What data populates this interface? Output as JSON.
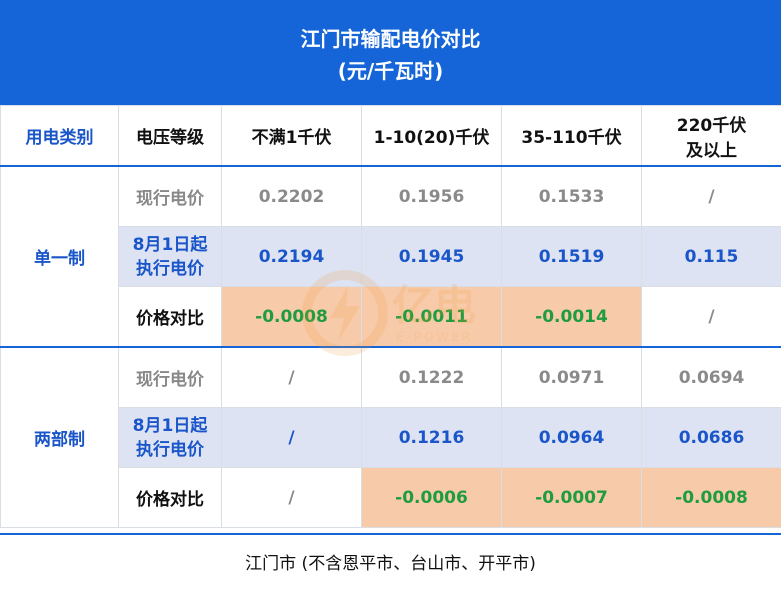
{
  "title": {
    "line1": "江门市输配电价对比",
    "line2": "(元/千瓦时)"
  },
  "header": {
    "category": "用电类别",
    "voltage_level": "电压等级",
    "col1": "不满1千伏",
    "col2": "1-10(20)千伏",
    "col3": "35-110千伏",
    "col4_line1": "220千伏",
    "col4_line2": "及以上"
  },
  "groups": [
    {
      "name": "单一制",
      "rows": [
        {
          "label": "现行电价",
          "values": [
            "0.2202",
            "0.1956",
            "0.1533",
            "/"
          ]
        },
        {
          "label_line1": "8月1日起",
          "label_line2": "执行电价",
          "values": [
            "0.2194",
            "0.1945",
            "0.1519",
            "0.115"
          ]
        },
        {
          "label": "价格对比",
          "values": [
            "-0.0008",
            "-0.0011",
            "-0.0014",
            "/"
          ]
        }
      ]
    },
    {
      "name": "两部制",
      "rows": [
        {
          "label": "现行电价",
          "values": [
            "/",
            "0.1222",
            "0.0971",
            "0.0694"
          ]
        },
        {
          "label_line1": "8月1日起",
          "label_line2": "执行电价",
          "values": [
            "/",
            "0.1216",
            "0.0964",
            "0.0686"
          ]
        },
        {
          "label": "价格对比",
          "values": [
            "/",
            "-0.0006",
            "-0.0007",
            "-0.0008"
          ]
        }
      ]
    }
  ],
  "watermark": {
    "text": "亿电",
    "sub": "E-POWER"
  },
  "footer": "江门市 (不含恩平市、台山市、开平市)",
  "colors": {
    "accent": "#1565d8",
    "negative": "#1f9c3f",
    "highlight": "#f7cbaa",
    "row_blue": "#dde3f3"
  }
}
